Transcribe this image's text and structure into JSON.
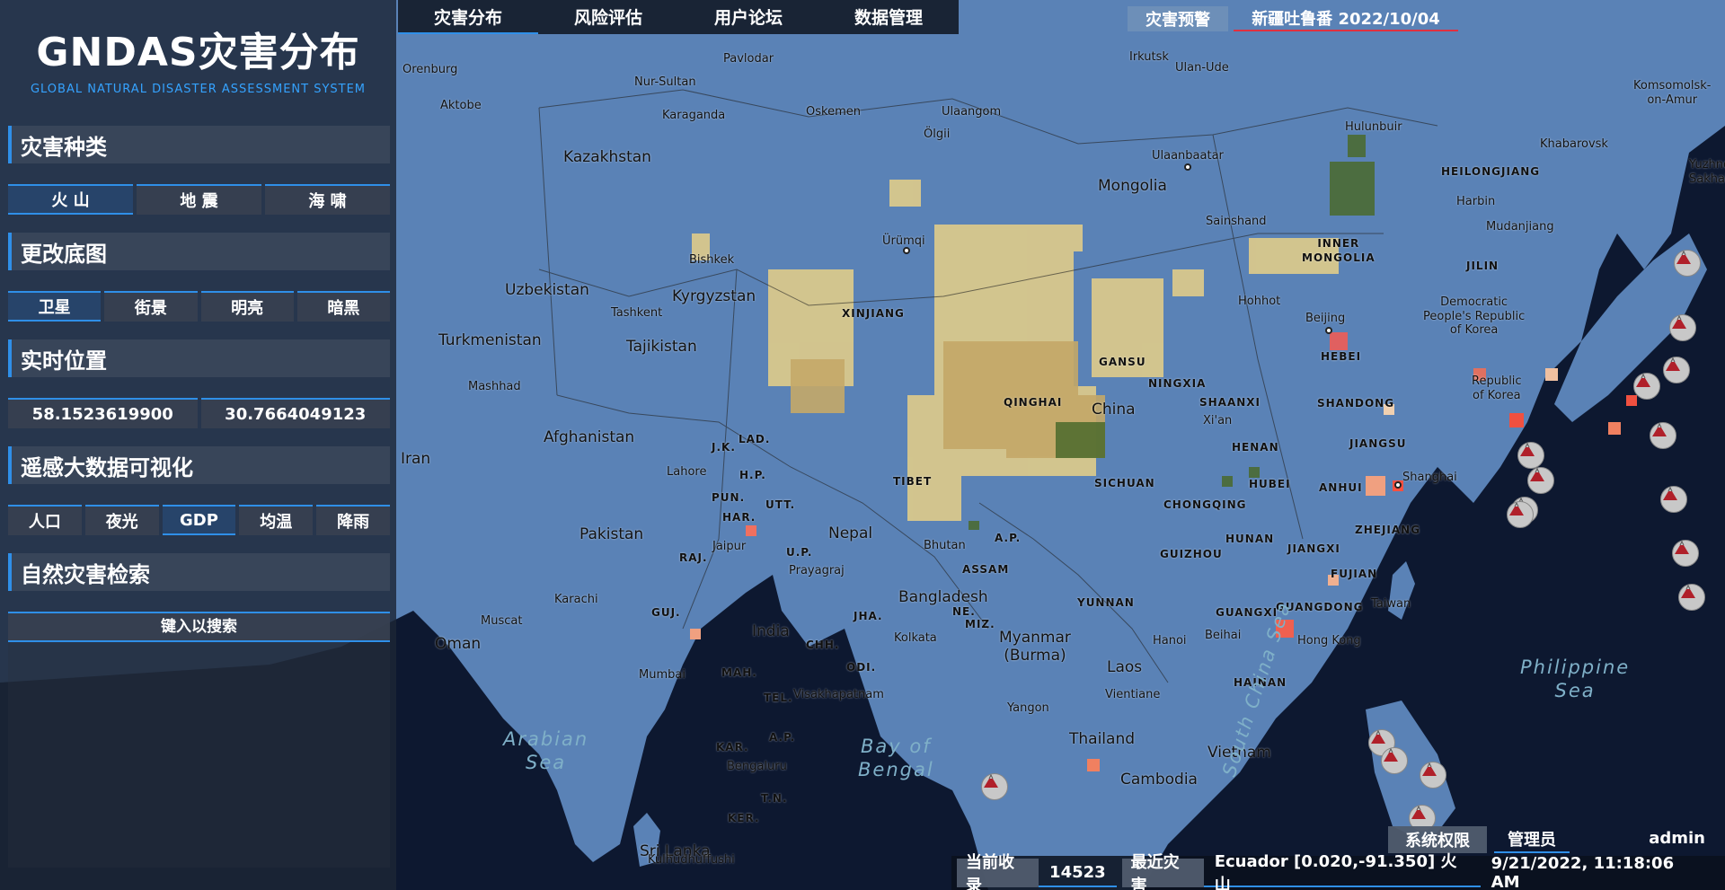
{
  "app": {
    "title": "GNDAS灾害分布",
    "subtitle": "GLOBAL NATURAL DISASTER ASSESSMENT SYSTEM"
  },
  "colors": {
    "accent": "#2f8fe8",
    "ocean": "#0d1830",
    "land": "#5a82b6",
    "alert": "#e03040"
  },
  "nav": {
    "tabs": [
      {
        "label": "灾害分布",
        "active": true
      },
      {
        "label": "风险评估",
        "active": false
      },
      {
        "label": "用户论坛",
        "active": false
      },
      {
        "label": "数据管理",
        "active": false
      }
    ]
  },
  "alert": {
    "button_label": "灾害预警",
    "info": "新疆吐鲁番  2022/10/04"
  },
  "sidebar": {
    "disaster_type": {
      "header": "灾害种类",
      "buttons": [
        "火 山",
        "地 震",
        "海 啸"
      ],
      "active_index": 0
    },
    "basemap": {
      "header": "更改底图",
      "buttons": [
        "卫星",
        "街景",
        "明亮",
        "暗黑"
      ],
      "active_index": 0
    },
    "location": {
      "header": "实时位置",
      "longitude": "58.1523619900",
      "latitude": "30.7664049123"
    },
    "remote_sensing": {
      "header": "遥感大数据可视化",
      "buttons": [
        "人口",
        "夜光",
        "GDP",
        "均温",
        "降雨"
      ],
      "active_index": 2
    },
    "search": {
      "header": "自然灾害检索",
      "placeholder": "键入以搜索"
    }
  },
  "user": {
    "permission_label": "系统权限",
    "role": "管理员",
    "name": "admin"
  },
  "status": {
    "count_label": "当前收录",
    "count": "14523",
    "recent_label": "最近灾害",
    "recent_value": "Ecuador [0.020,-91.350] 火山",
    "datetime": "9/21/2022, 11:18:06 AM"
  },
  "map": {
    "countries": [
      "Kazakhstan",
      "Mongolia",
      "Uzbekistan",
      "Kyrgyzstan",
      "Turkmenistan",
      "Tajikistan",
      "Afghanistan",
      "Iran",
      "Pakistan",
      "Nepal",
      "Bhutan",
      "India",
      "Bangladesh",
      "China",
      "Myanmar\n(Burma)",
      "Laos",
      "Thailand",
      "Vietnam",
      "Cambodia",
      "Sri Lanka",
      "Oman",
      "Taiwan",
      "Democratic\nPeople's Republic\nof Korea",
      "Republic\nof Korea"
    ],
    "provinces": [
      "XINJIANG",
      "TIBET",
      "QINGHAI",
      "GANSU",
      "INNER\nMONGOLIA",
      "HEILONGJIANG",
      "JILIN",
      "HEBEI",
      "NINGXIA",
      "SHAANXI",
      "SHANDONG",
      "HENAN",
      "JIANGSU",
      "SICHUAN",
      "HUBEI",
      "ANHUI",
      "CHONGQING",
      "HUNAN",
      "JIANGXI",
      "ZHEJIANG",
      "GUIZHOU",
      "FUJIAN",
      "YUNNAN",
      "GUANGXI",
      "GUANGDONG",
      "HAINAN",
      "J.K.",
      "LAD.",
      "H.P.",
      "PUN.",
      "HAR.",
      "UTT.",
      "U.P.",
      "RAJ.",
      "GUJ.",
      "MAH.",
      "TEL.",
      "A.P.",
      "KAR.",
      "T.N.",
      "KER.",
      "ODI.",
      "CHH.",
      "JHA.",
      "ASSAM",
      "A.P.",
      "NE.",
      "MIZ."
    ],
    "cities": [
      "Orenburg",
      "Pavlodar",
      "Irkutsk",
      "Ulan-Ude",
      "Komsomolsk-\non-Amur",
      "Aktobe",
      "Nur-Sultan",
      "Karaganda",
      "Oskemen",
      "Ulaangom",
      "Ölgii",
      "Hulunbuir",
      "Khabarovsk",
      "Yuzhno-\nSakhalin",
      "Ulaanbaatar",
      "Harbin",
      "Mudanjiang",
      "Sainshand",
      "Ürümqi",
      "Bishkek",
      "Tashkent",
      "Hohhot",
      "Beijing",
      "Mashhad",
      "Xi'an",
      "Shanghai",
      "Lahore",
      "Jaipur",
      "Prayagraj",
      "Karachi",
      "Muscat",
      "Kolkata",
      "Hong Kong",
      "Hanoi",
      "Beihai",
      "Vientiane",
      "Yangon",
      "Mumbai",
      "Visakhapatnam",
      "Bengaluru",
      "Kulhudhuffushi"
    ],
    "seas": [
      "Arabian\nSea",
      "Bay of\nBengal",
      "Philippine\nSea",
      "South China Sea"
    ]
  }
}
